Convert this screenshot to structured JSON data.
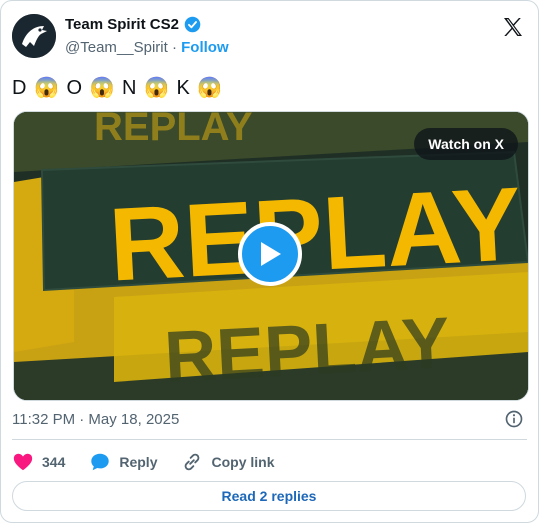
{
  "author": {
    "name": "Team Spirit CS2",
    "handle": "@Team__Spirit",
    "dot": "·",
    "follow_label": "Follow"
  },
  "tweet": {
    "text": "D 😱 O 😱 N 😱 K 😱"
  },
  "media": {
    "watch_label": "Watch on X",
    "overlay_word": "REPLAY"
  },
  "meta": {
    "timestamp": "11:32 PM · May 18, 2025"
  },
  "actions": {
    "likes": "344",
    "reply_label": "Reply",
    "copy_label": "Copy link"
  },
  "replies_button": "Read 2 replies",
  "colors": {
    "accent": "#1d9bf0",
    "like": "#f91880",
    "yellow": "#f5b800",
    "dark": "#20361f"
  },
  "icons": [
    "verified-badge-icon",
    "x-logo-icon",
    "play-icon",
    "info-icon",
    "heart-icon",
    "reply-icon",
    "link-icon"
  ]
}
